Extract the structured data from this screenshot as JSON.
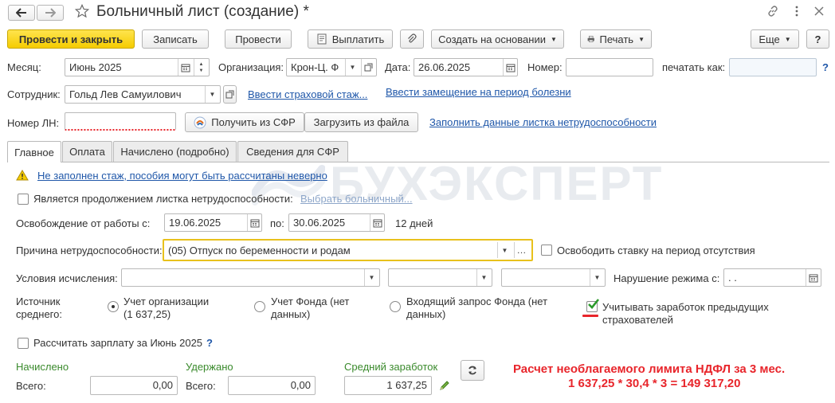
{
  "titlebar": {
    "title": "Больничный лист (создание) *",
    "back_icon": "arrow-left-icon",
    "forward_icon": "arrow-right-icon",
    "star_icon": "star-icon",
    "link_icon": "link-icon",
    "more_icon": "more-vertical-icon",
    "close_icon": "close-icon"
  },
  "toolbar": {
    "post_close": "Провести и закрыть",
    "save": "Записать",
    "post": "Провести",
    "pay": "Выплатить",
    "create_based_on": "Создать на основании",
    "print": "Печать",
    "more": "Еще",
    "help": "?"
  },
  "header": {
    "month_label": "Месяц:",
    "month_value": "Июнь 2025",
    "org_label": "Организация:",
    "org_value": "Крон-Ц. Ф",
    "date_label": "Дата:",
    "date_value": "26.06.2025",
    "number_label": "Номер:",
    "number_value": "",
    "print_as_label": "печатать как:",
    "print_as_value": "",
    "help": "?",
    "employee_label": "Сотрудник:",
    "employee_value": "Гольд Лев Самуилович",
    "insurance_link": "Ввести страховой стаж...",
    "replacement_link": "Ввести замещение на период болезни",
    "ln_label": "Номер ЛН:",
    "ln_value": "",
    "get_sfr": "Получить из СФР",
    "load_file": "Загрузить из файла",
    "fill_link": "Заполнить данные листка нетрудоспособности"
  },
  "tabs": [
    {
      "label": "Главное",
      "active": true
    },
    {
      "label": "Оплата",
      "active": false
    },
    {
      "label": "Начислено (подробно)",
      "active": false
    },
    {
      "label": "Сведения для СФР",
      "active": false
    }
  ],
  "main": {
    "warning_link": "Не заполнен стаж, пособия могут быть рассчитаны неверно",
    "continuation_label": "Является продолжением листка нетрудоспособности:",
    "continuation_checked": false,
    "choose_sick_link": "Выбрать больничный...",
    "release_label": "Освобождение от работы с:",
    "release_from": "19.06.2025",
    "po_label": "по:",
    "release_to": "30.06.2025",
    "days_text": "12 дней",
    "reason_label": "Причина нетрудоспособности:",
    "reason_value": "(05) Отпуск по беременности и родам",
    "release_rate_label": "Освободить ставку на период отсутствия",
    "release_rate_checked": false,
    "conditions_label": "Условия исчисления:",
    "cond1": "",
    "cond2": "",
    "cond3": "",
    "violation_label": "Нарушение режима с:",
    "violation_value": " .  .",
    "source_label": "Источник среднего:",
    "source_org_line1": "Учет организации",
    "source_org_line2": "(1 637,25)",
    "source_fund_line1": "Учет Фонда (нет",
    "source_fund_line2": "данных)",
    "source_request_line1": "Входящий запрос Фонда (нет",
    "source_request_line2": "данных)",
    "source_selected": "org",
    "prev_insurers_line1": "Учитывать заработок предыдущих",
    "prev_insurers_line2": "страхователей",
    "prev_insurers_checked": true,
    "calc_salary_label": "Рассчитать зарплату за Июнь 2025",
    "calc_salary_checked": false,
    "help": "?",
    "accrued_title": "Начислено",
    "accrued_total_label": "Всего:",
    "accrued_total": "0,00",
    "withheld_title": "Удержано",
    "withheld_total_label": "Всего:",
    "withheld_total": "0,00",
    "avg_title": "Средний заработок",
    "avg_value": "1 637,25",
    "annotation_line1": "Расчет необлагаемого лимита НДФЛ за 3 мес.",
    "annotation_line2": "1 637,25 * 30,4 * 3 = 149 317,20"
  },
  "watermark": "БУХЭКСПЕРТ",
  "colors": {
    "primary_button": "#f5cc00",
    "link": "#1f57a9",
    "green_title": "#3a8a2c",
    "annotation_red": "#e8252b",
    "focus_border": "#e8c11c"
  }
}
